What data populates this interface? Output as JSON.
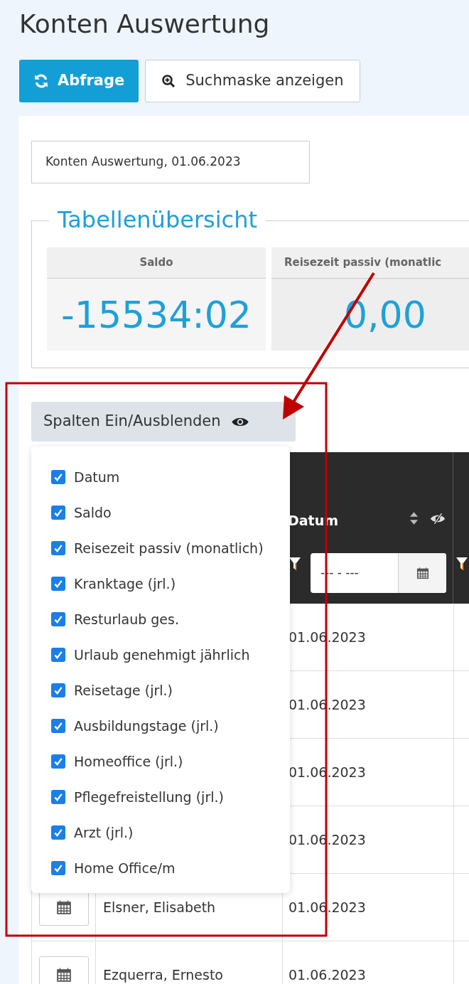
{
  "title": "Konten Auswertung",
  "buttons": [
    {
      "label": "Abfrage",
      "kind": "primary"
    },
    {
      "label": "Suchmaske anzeigen",
      "kind": "default"
    }
  ],
  "report_label": "Konten Auswertung, 01.06.2023",
  "overview": {
    "title": "Tabellenübersicht",
    "tiles": [
      {
        "label": "Saldo",
        "value": "-15534:02"
      },
      {
        "label": "Reisezeit passiv (monatlic",
        "value": "0,00"
      }
    ]
  },
  "column_toggle": {
    "label": "Spalten Ein/Ausblenden",
    "options": [
      {
        "label": "Datum",
        "checked": true
      },
      {
        "label": "Saldo",
        "checked": true
      },
      {
        "label": "Reisezeit passiv (monatlich)",
        "checked": true
      },
      {
        "label": "Kranktage (jrl.)",
        "checked": true
      },
      {
        "label": "Resturlaub ges.",
        "checked": true
      },
      {
        "label": "Urlaub genehmigt jährlich",
        "checked": true
      },
      {
        "label": "Reisetage (jrl.)",
        "checked": true
      },
      {
        "label": "Ausbildungstage (jrl.)",
        "checked": true
      },
      {
        "label": "Homeoffice (jrl.)",
        "checked": true
      },
      {
        "label": "Pflegefreistellung (jrl.)",
        "checked": true
      },
      {
        "label": "Arzt (jrl.)",
        "checked": true
      },
      {
        "label": "Home Office/m",
        "checked": true
      }
    ]
  },
  "table": {
    "date_column": {
      "label": "Datum",
      "filter_placeholder": "--- - ---"
    },
    "rows": [
      {
        "date": "01.06.2023"
      },
      {
        "date": "01.06.2023"
      },
      {
        "date": "01.06.2023"
      },
      {
        "date": "01.06.2023"
      },
      {
        "name": "Elsner, Elisabeth",
        "date": "01.06.2023"
      },
      {
        "name": "Ezquerra, Ernesto",
        "date": "01.06.2023"
      }
    ]
  }
}
